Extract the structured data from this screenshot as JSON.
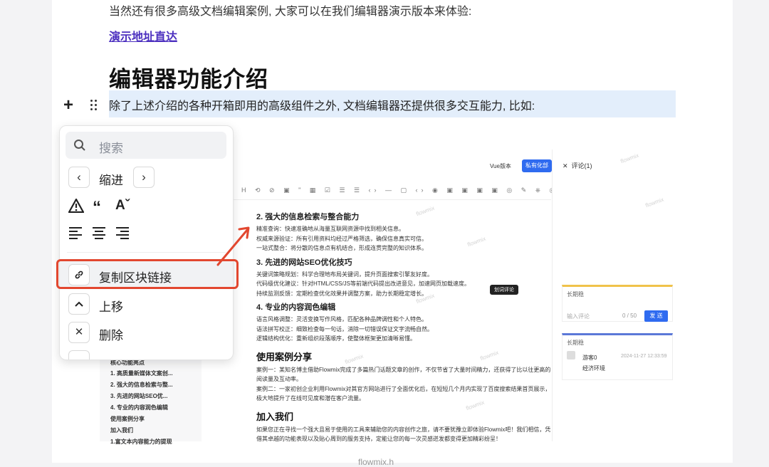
{
  "document": {
    "intro": "当然还有很多高级文档编辑案例, 大家可以在我们编辑器演示版本来体验:",
    "link_text": "演示地址直达",
    "heading": "编辑器功能介绍",
    "highlighted_paragraph": "除了上述介绍的各种开箱即用的高级组件之外, 文档编辑器还提供很多交互能力, 比如:",
    "footer_partial": "flowmix.h"
  },
  "block_menu": {
    "search_placeholder": "搜索",
    "indent_label": "缩进",
    "indent_prev": "‹",
    "indent_next": "›",
    "copy_link_label": "复制区块链接",
    "move_up_label": "上移",
    "delete_label": "删除"
  },
  "screenshot": {
    "vue_label": "Vue版本",
    "private_btn": "私有化部",
    "comment_title": "评论(1)",
    "watermark": "flowmix",
    "sections": [
      {
        "title": "2. 强大的信息检索与整合能力",
        "items": [
          "精准查询：快速准确地从海量互联网资源中找到相关信息。",
          "权威来源验证：所有引用资料均经过严格筛选，确保信息真实可信。",
          "一站式整合：将分散的信息点有机结合，形成连贯完整的知识体系。"
        ]
      },
      {
        "title": "3. 先进的网站SEO优化技巧",
        "items": [
          "关键词策略规划：科学合理地布局关键词，提升页面搜索引擎友好度。",
          "代码级优化建议：针对HTML/CSS/JS等前端代码提出改进意见，加速网页加载速度。",
          "持续监测反馈：定期检查优化效果并调整方案，助力长期稳定增长。"
        ]
      },
      {
        "title": "4. 专业的内容润色编辑",
        "items": [
          "语言风格调整：灵活变换写作风格，匹配各种品牌调性和个人特色。",
          "语法拼写校正：细致检查每一句话，消除一切错误保证文字流畅自然。",
          "逻辑结构优化：重新组织段落顺序，使整体框架更加清晰易懂。"
        ]
      }
    ],
    "usage_title": "使用案例分享",
    "usage_items": [
      "案例一：某知名博主借助Flowmix完成了多篇热门话题文章的创作，不仅节省了大量时间精力，还获得了比以往更高的阅读量及互动率。",
      "案例二：一家初创企业利用Flowmix对其官方网站进行了全面优化后，在短短几个月内实现了百度搜索结果首页展示，极大地提升了在线可见度和潜在客户流量。"
    ],
    "join_title": "加入我们",
    "join_text": "如果您正在寻找一个强大且易于使用的工具来辅助您的内容创作之旅，请不要犹豫立即体验Flowmix吧！我们相信，凭借其卓越的功能表现以及贴心周到的服务支持，定能让您的每一次灵感迸发都变得更加精彩纷呈！",
    "tooltip": "划词评论",
    "card1_title": "长期稳",
    "comment_placeholder": "输入评论",
    "comment_count": "0 / 50",
    "send_label": "发 送",
    "card2_title": "长期稳",
    "card2_user": "游客0",
    "card2_time": "2024-11-27 12:33:59",
    "card2_text": "经济环境",
    "outline": [
      "核心功能亮点",
      "1. 高质量新媒体文案创...",
      "2. 强大的信息检索与整...",
      "3. 先进的网站SEO优...",
      "4. 专业的内容润色编辑",
      "使用案例分享",
      "加入我们",
      "1.富文本内容能力的提现"
    ]
  },
  "colors": {
    "highlight": "#e3eefb",
    "annotation_red": "#e2472f",
    "link": "#4b2fbf",
    "accent_blue": "#2f6bf0"
  }
}
